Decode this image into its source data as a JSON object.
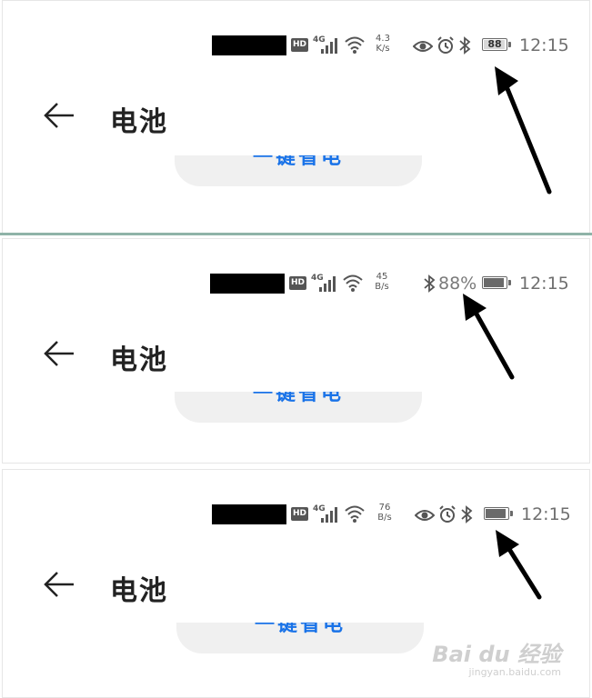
{
  "panels": [
    {
      "net_label": "4G",
      "speed_value": "4.3",
      "speed_unit": "K/s",
      "battery_level": "88",
      "time": "12:15",
      "title": "电池",
      "action_label": "一键省电"
    },
    {
      "net_label": "4G",
      "speed_value": "45",
      "speed_unit": "B/s",
      "battery_percent": "88%",
      "time": "12:15",
      "title": "电池",
      "action_label": "一键省电"
    },
    {
      "net_label": "4G",
      "speed_value": "76",
      "speed_unit": "B/s",
      "time": "12:15",
      "title": "电池",
      "action_label": "一键省电"
    }
  ],
  "hd_label": "HD",
  "icons": [
    "eye-icon",
    "alarm-icon",
    "bluetooth-icon",
    "battery-icon",
    "signal-icon",
    "wifi-icon",
    "back-arrow-icon"
  ],
  "watermark": {
    "brand": "Bai du 经验",
    "url": "jingyan.baidu.com"
  },
  "colors": {
    "accent": "#1a73e8",
    "annotation_arrow": "#000000",
    "divider": "#8fb3a8"
  }
}
